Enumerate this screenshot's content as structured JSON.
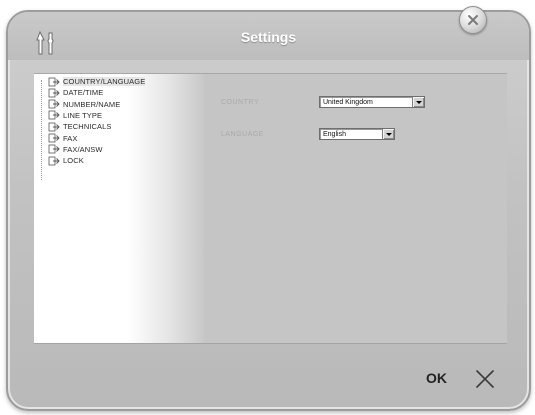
{
  "window": {
    "title": "Settings"
  },
  "tree": {
    "items": [
      {
        "label": "COUNTRY/LANGUAGE",
        "selected": true
      },
      {
        "label": "DATE/TIME",
        "selected": false
      },
      {
        "label": "NUMBER/NAME",
        "selected": false
      },
      {
        "label": "LINE TYPE",
        "selected": false
      },
      {
        "label": "TECHNICALS",
        "selected": false
      },
      {
        "label": "FAX",
        "selected": false
      },
      {
        "label": "FAX/ANSW",
        "selected": false
      },
      {
        "label": "LOCK",
        "selected": false
      }
    ]
  },
  "form": {
    "country": {
      "label": "COUNTRY",
      "value": "United Kingdom"
    },
    "language": {
      "label": "LANGUAGE",
      "value": "English"
    }
  },
  "footer": {
    "ok_label": "OK"
  },
  "icons": {
    "logo": "tools-logo-icon",
    "close": "close-bubble-icon",
    "tree_item": "page-arrow-icon",
    "cancel": "cancel-x-icon"
  }
}
